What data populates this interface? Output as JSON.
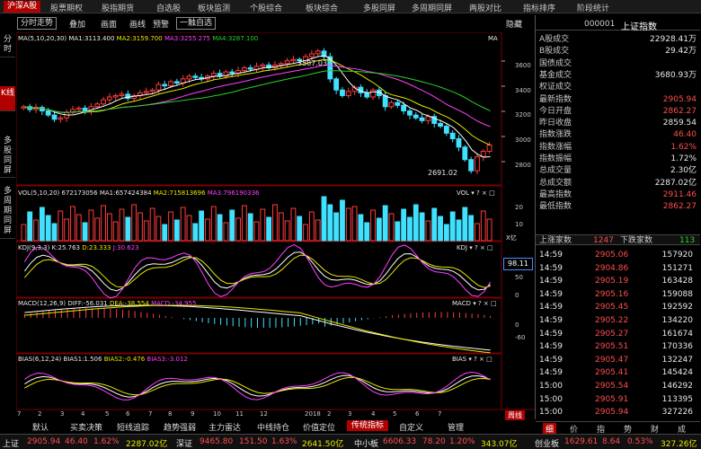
{
  "menu": [
    "沪深A股",
    "股票期权",
    "股指期货",
    "自选股",
    "板块监测",
    "个股综合",
    "板块综合",
    "多股同屏",
    "多周期同屏",
    "两股对比",
    "指标排序",
    "阶段统计"
  ],
  "toolbar": {
    "time_share": "分时走势",
    "overlay": "叠加",
    "draw": "画面",
    "line_draw": "画线",
    "forecast": "预警",
    "period": "一触自选",
    "hide": "隐藏"
  },
  "left_tabs": [
    "分时",
    "K线",
    "多股同屏",
    "多周期同屏"
  ],
  "ma_legend": {
    "title": "MA(5,10,20,30)",
    "ma1": "MA1:3113.400",
    "ma2": "MA2:3159.700",
    "ma3": "MA3:3255.275",
    "ma4": "MA4:3287.100",
    "tag": "MA"
  },
  "annotations": {
    "high": "3587.03",
    "low": "2691.02"
  },
  "vol_legend": {
    "title": "VOL(5,10,20)",
    "val": "672173056",
    "ma1": "MA1:657424384",
    "ma2": "MA2:715813696",
    "ma3": "MA3:796190336",
    "tag": "VOL",
    "unit": "X亿"
  },
  "kdj_legend": {
    "title": "KDJ(9,3,3)",
    "k": "K:25.763",
    "d": "D:23.333",
    "j": "J:30.623",
    "tag": "KDJ",
    "cursor": "98.11"
  },
  "macd_legend": {
    "title": "MACD(12,26,9)",
    "diff": "DIFF:-56.031",
    "dea": "DEA:-38.554",
    "macd": "MACD:-34.955",
    "tag": "MACD"
  },
  "bias_legend": {
    "title": "BIAS(6,12,24)",
    "b1": "BIAS1:1.506",
    "b2": "BIAS2:-0.476",
    "b3": "BIAS3:-3.012",
    "tag": "BIAS"
  },
  "right_axis": {
    "price": [
      "3600",
      "3400",
      "3200",
      "3000",
      "2800"
    ],
    "vol": [
      "20",
      "10"
    ],
    "kdj": [
      "100",
      "50",
      "0"
    ],
    "macd": [
      "0",
      "-60"
    ]
  },
  "x_axis": [
    "7",
    "2",
    "3",
    "4",
    "5",
    "6",
    "7",
    "8",
    "9",
    "10",
    "11",
    "12",
    "2018",
    "2",
    "3",
    "4",
    "5",
    "6",
    "7"
  ],
  "quote": {
    "code": "000001",
    "name": "上证指数",
    "rows": [
      {
        "k": "A股成交",
        "v": "22928.41万",
        "c": "white"
      },
      {
        "k": "B股成交",
        "v": "29.42万",
        "c": "white"
      },
      {
        "k": "国债成交",
        "v": "",
        "c": "white"
      },
      {
        "k": "基金成交",
        "v": "3680.93万",
        "c": "white"
      },
      {
        "k": "权证成交",
        "v": "",
        "c": "white"
      },
      {
        "k": "最新指数",
        "v": "2905.94",
        "c": "red"
      },
      {
        "k": "今日开盘",
        "v": "2862.27",
        "c": "red"
      },
      {
        "k": "昨日收盘",
        "v": "2859.54",
        "c": "white"
      },
      {
        "k": "指数涨跌",
        "v": "46.40",
        "c": "red"
      },
      {
        "k": "指数涨幅",
        "v": "1.62%",
        "c": "red"
      },
      {
        "k": "指数振幅",
        "v": "1.72%",
        "c": "white"
      },
      {
        "k": "总成交量",
        "v": "2.30亿",
        "c": "white"
      },
      {
        "k": "总成交额",
        "v": "2287.02亿",
        "c": "white"
      },
      {
        "k": "最高指数",
        "v": "2911.46",
        "c": "red"
      },
      {
        "k": "最低指数",
        "v": "2862.27",
        "c": "red"
      }
    ],
    "up_label": "上涨家数",
    "up": "1247",
    "down_label": "下跌家数",
    "down": "113"
  },
  "ticks": [
    {
      "t": "14:59",
      "p": "2905.06",
      "v": "157920"
    },
    {
      "t": "14:59",
      "p": "2904.86",
      "v": "151271"
    },
    {
      "t": "14:59",
      "p": "2905.19",
      "v": "163428"
    },
    {
      "t": "14:59",
      "p": "2905.16",
      "v": "159088"
    },
    {
      "t": "14:59",
      "p": "2905.45",
      "p2": "",
      "v": "192592"
    },
    {
      "t": "14:59",
      "p": "2905.22",
      "v": "134220"
    },
    {
      "t": "14:59",
      "p": "2905.27",
      "v": "161674"
    },
    {
      "t": "14:59",
      "p": "2905.51",
      "v": "170336"
    },
    {
      "t": "14:59",
      "p": "2905.47",
      "v": "132247"
    },
    {
      "t": "14:59",
      "p": "2905.41",
      "v": "145424"
    },
    {
      "t": "15:00",
      "p": "2905.54",
      "v": "146292"
    },
    {
      "t": "15:00",
      "p": "2905.91",
      "v": "113395"
    },
    {
      "t": "15:00",
      "p": "2905.94",
      "v": "327226"
    }
  ],
  "panel_tabs": [
    "细",
    "价",
    "指",
    "势",
    "财",
    "成"
  ],
  "bottom_tabs": [
    "默认",
    "买卖决策",
    "短线追踪",
    "趋势强弱",
    "主力雷达",
    "中线持仓",
    "价值定位",
    "传统指标",
    "自定义",
    "管理"
  ],
  "bottom_week": "周线",
  "status": {
    "sh_label": "上证",
    "sh_val": "2905.94",
    "sh_chg": "46.40",
    "sh_pct": "1.62%",
    "sh_amt": "2287.02亿",
    "sz_label": "深证",
    "sz_val": "9465.80",
    "sz_chg": "151.50",
    "sz_pct": "1.63%",
    "sz_amt": "2641.50亿",
    "zx_label": "中小板",
    "zx_val": "6606.33",
    "zx_chg": "78.20",
    "zx_pct": "1.20%",
    "zx_amt": "343.07亿",
    "cy_label": "创业板",
    "cy_val": "1629.61",
    "cy_chg": "8.64",
    "cy_pct": "0.53%",
    "cy_amt": "327.26亿"
  },
  "chart_data": {
    "type": "candlestick",
    "title": "",
    "x_labels": [
      "7",
      "2",
      "3",
      "4",
      "5",
      "6",
      "7",
      "8",
      "9",
      "10",
      "11",
      "12",
      "2018",
      "2",
      "3",
      "4",
      "5",
      "6",
      "7"
    ],
    "price_range": [
      2691.02,
      3587.03
    ],
    "closes": [
      3180,
      3160,
      3175,
      3150,
      3120,
      3090,
      3100,
      3140,
      3160,
      3170,
      3150,
      3180,
      3200,
      3230,
      3250,
      3260,
      3270,
      3240,
      3260,
      3280,
      3290,
      3300,
      3340,
      3330,
      3360,
      3350,
      3380,
      3400,
      3390,
      3380,
      3400,
      3420,
      3400,
      3430,
      3420,
      3440,
      3460,
      3450,
      3470,
      3480,
      3460,
      3480,
      3490,
      3510,
      3520,
      3510,
      3540,
      3560,
      3580,
      3540,
      3380,
      3300,
      3260,
      3290,
      3320,
      3280,
      3250,
      3300,
      3260,
      3180,
      3210,
      3190,
      3150,
      3120,
      3100,
      3080,
      3110,
      3060,
      3040,
      2990,
      2950,
      2890,
      2800,
      2720,
      2820,
      2860,
      2905
    ],
    "volume_scale": [
      0,
      20
    ],
    "kdj_scale": [
      0,
      100
    ],
    "macd_scale": [
      -60,
      0
    ]
  }
}
